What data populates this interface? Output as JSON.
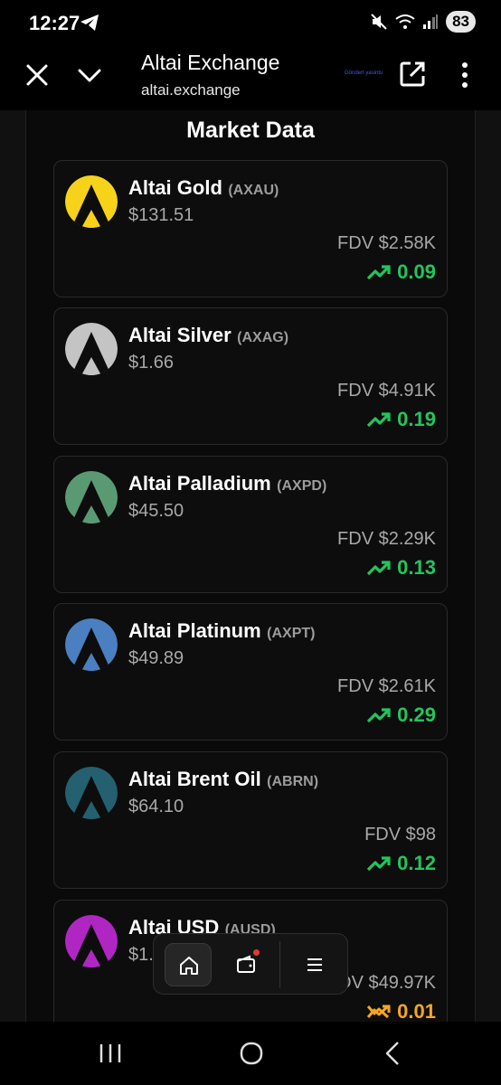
{
  "status_bar": {
    "time": "12:27",
    "battery": "83"
  },
  "browser": {
    "title": "Altai Exchange",
    "url": "altai.exchange",
    "tag": "Göndert yasintu"
  },
  "market": {
    "title": "Market Data",
    "assets": [
      {
        "name": "Altai Gold",
        "symbol": "(AXAU)",
        "price": "$131.51",
        "fdv": "FDV $2.58K",
        "change": "0.09",
        "trend": "up",
        "logo_color": "#f7d21a"
      },
      {
        "name": "Altai Silver",
        "symbol": "(AXAG)",
        "price": "$1.66",
        "fdv": "FDV $4.91K",
        "change": "0.19",
        "trend": "up",
        "logo_color": "#c4c4c4"
      },
      {
        "name": "Altai Palladium",
        "symbol": "(AXPD)",
        "price": "$45.50",
        "fdv": "FDV $2.29K",
        "change": "0.13",
        "trend": "up",
        "logo_color": "#5a9a72"
      },
      {
        "name": "Altai Platinum",
        "symbol": "(AXPT)",
        "price": "$49.89",
        "fdv": "FDV $2.61K",
        "change": "0.29",
        "trend": "up",
        "logo_color": "#4a7fc1"
      },
      {
        "name": "Altai Brent Oil",
        "symbol": "(ABRN)",
        "price": "$64.10",
        "fdv": "FDV $98",
        "change": "0.12",
        "trend": "up",
        "logo_color": "#24606f"
      },
      {
        "name": "Altai USD",
        "symbol": "(AUSD)",
        "price": "$1.0",
        "fdv": "FDV $49.97K",
        "change": "0.01",
        "trend": "mixed",
        "logo_color": "#b026c2"
      }
    ]
  },
  "colors": {
    "up": "#22c55e",
    "mixed": "#f5a623"
  },
  "float_nav": {
    "items": [
      "home-icon",
      "wallet-icon",
      "menu-icon"
    ]
  }
}
